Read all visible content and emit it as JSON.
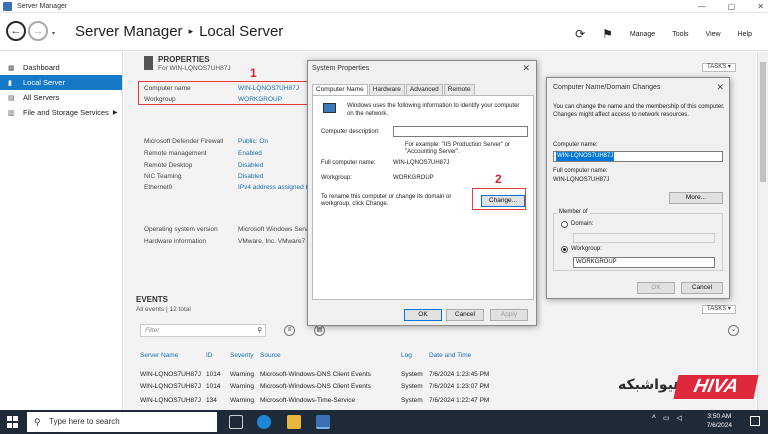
{
  "window": {
    "title": "Server Manager",
    "controls": [
      "—",
      "▢",
      "✕"
    ]
  },
  "header": {
    "breadcrumb_root": "Server Manager",
    "breadcrumb_sep": "▸",
    "breadcrumb_current": "Local Server",
    "menu": {
      "manage": "Manage",
      "tools": "Tools",
      "view": "View",
      "help": "Help"
    }
  },
  "sidebar": {
    "items": [
      {
        "label": "Dashboard",
        "icon": "dashboard-icon"
      },
      {
        "label": "Local Server",
        "icon": "server-icon"
      },
      {
        "label": "All Servers",
        "icon": "servers-icon"
      },
      {
        "label": "File and Storage Services",
        "icon": "storage-icon"
      }
    ]
  },
  "properties": {
    "title": "PROPERTIES",
    "subtitle": "For WIN-LQNOS7UH87J",
    "tasks": "TASKS",
    "rows": [
      {
        "label": "Computer name",
        "value": "WIN-LQNOS7UH87J"
      },
      {
        "label": "Workgroup",
        "value": "WORKGROUP"
      },
      {
        "label": "Microsoft Defender Firewall",
        "value": "Public: On"
      },
      {
        "label": "Remote management",
        "value": "Enabled"
      },
      {
        "label": "Remote Desktop",
        "value": "Disabled"
      },
      {
        "label": "NIC Teaming",
        "value": "Disabled"
      },
      {
        "label": "Ethernet0",
        "value": "IPv4 address assigned b"
      },
      {
        "label": "Operating system version",
        "value": "Microsoft Windows Serv"
      },
      {
        "label": "Hardware information",
        "value": "VMware, Inc. VMware7"
      }
    ]
  },
  "annotations": {
    "one": "1",
    "two": "2"
  },
  "events": {
    "title": "EVENTS",
    "subtitle": "All events | 12 total",
    "tasks": "TASKS",
    "filter_placeholder": "Filter",
    "columns": [
      "Server Name",
      "ID",
      "Severity",
      "Source",
      "Log",
      "Date and Time"
    ],
    "rows": [
      [
        "WIN-LQNOS7UH87J",
        "1014",
        "Warning",
        "Microsoft-Windows-DNS Client Events",
        "System",
        "7/6/2024 1:23:45 PM"
      ],
      [
        "WIN-LQNOS7UH87J",
        "1014",
        "Warning",
        "Microsoft-Windows-DNS Client Events",
        "System",
        "7/6/2024 1:23:07 PM"
      ],
      [
        "WIN-LQNOS7UH87J",
        "134",
        "Warning",
        "Microsoft-Windows-Time-Service",
        "System",
        "7/6/2024 1:22:47 PM"
      ]
    ]
  },
  "system_properties": {
    "title": "System Properties",
    "tabs": [
      "Computer Name",
      "Hardware",
      "Advanced",
      "Remote"
    ],
    "intro": "Windows uses the following information to identify your computer on the network.",
    "description_label": "Computer description:",
    "example": "For example: \"IIS Production Server\" or \"Accounting Server\".",
    "full_name_label": "Full computer name:",
    "full_name_value": "WIN-LQNOS7UH87J",
    "workgroup_label": "Workgroup:",
    "workgroup_value": "WORKGROUP",
    "rename_text": "To rename this computer or change its domain or workgroup, click Change.",
    "change_btn": "Change...",
    "ok": "OK",
    "cancel": "Cancel",
    "apply": "Apply"
  },
  "name_changes": {
    "title": "Computer Name/Domain Changes",
    "intro": "You can change the name and the membership of this computer. Changes might affect access to network resources.",
    "computer_name_label": "Computer name:",
    "computer_name_value": "WIN-LQNOS7UH87J",
    "full_name_label": "Full computer name:",
    "full_name_value": "WIN-LQNOS7UH87J",
    "more_btn": "More...",
    "member_of": "Member of",
    "domain_label": "Domain:",
    "workgroup_label": "Workgroup:",
    "workgroup_value": "WORKGROUP",
    "ok": "OK",
    "cancel": "Cancel"
  },
  "logo": {
    "latin": "HIVA",
    "farsi": "هیواشبکه"
  },
  "taskbar": {
    "search_placeholder": "Type here to search",
    "time": "3:50 AM",
    "date": "7/6/2024",
    "apps": [
      "task-view-icon",
      "edge-icon",
      "file-explorer-icon",
      "server-manager-icon"
    ]
  }
}
